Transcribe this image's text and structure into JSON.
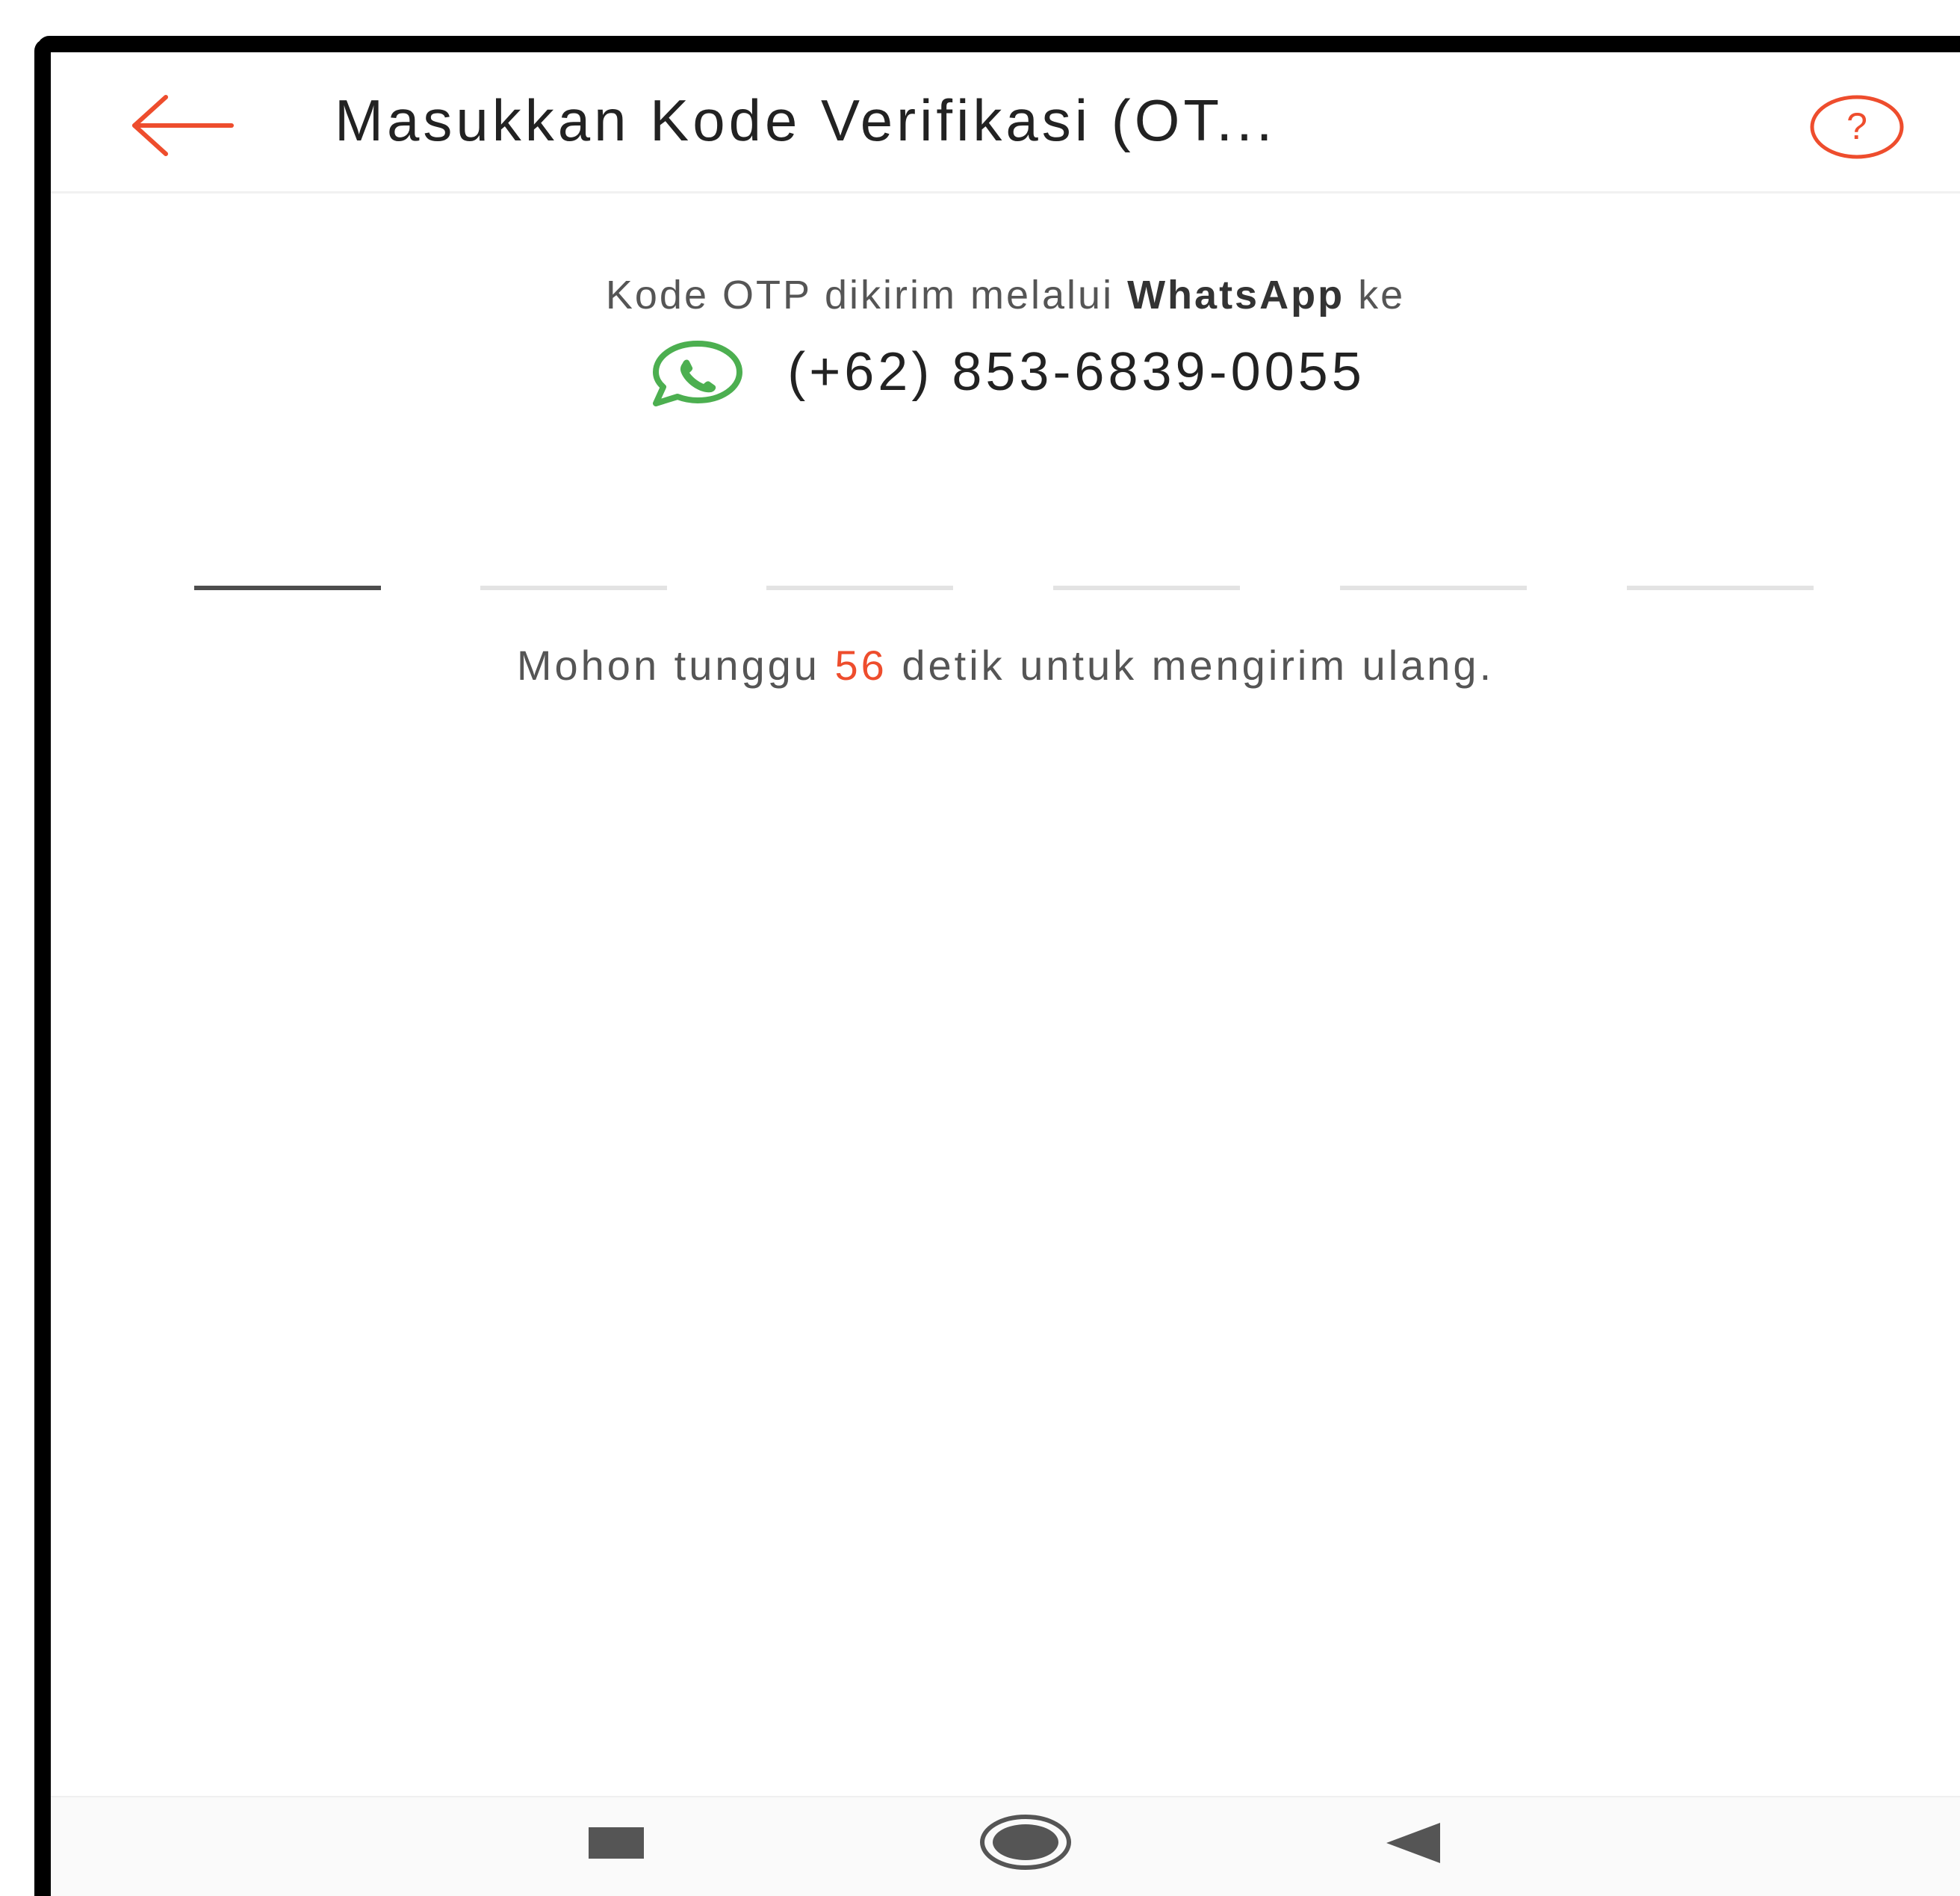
{
  "header": {
    "title": "Masukkan Kode Verifikasi (OT...",
    "back_icon": "arrow-left-icon",
    "help_icon": "question-circle-icon"
  },
  "otp_info": {
    "sent_prefix": "Kode OTP dikirim melalui ",
    "channel": "WhatsApp",
    "sent_suffix": " ke",
    "channel_icon": "whatsapp-icon",
    "phone_number": "(+62) 853-6839-0055"
  },
  "otp_input": {
    "digits": [
      "",
      "",
      "",
      "",
      "",
      ""
    ],
    "active_index": 0
  },
  "resend": {
    "prefix": "Mohon tunggu ",
    "seconds": "56",
    "suffix": " detik untuk mengirim ulang."
  },
  "nav_bar": {
    "icons": [
      "recent-apps-icon",
      "home-icon",
      "back-triangle-icon"
    ]
  },
  "colors": {
    "accent": "#ee4d2d",
    "whatsapp_green": "#4caf50",
    "text_primary": "#222222",
    "text_secondary": "#555555"
  }
}
